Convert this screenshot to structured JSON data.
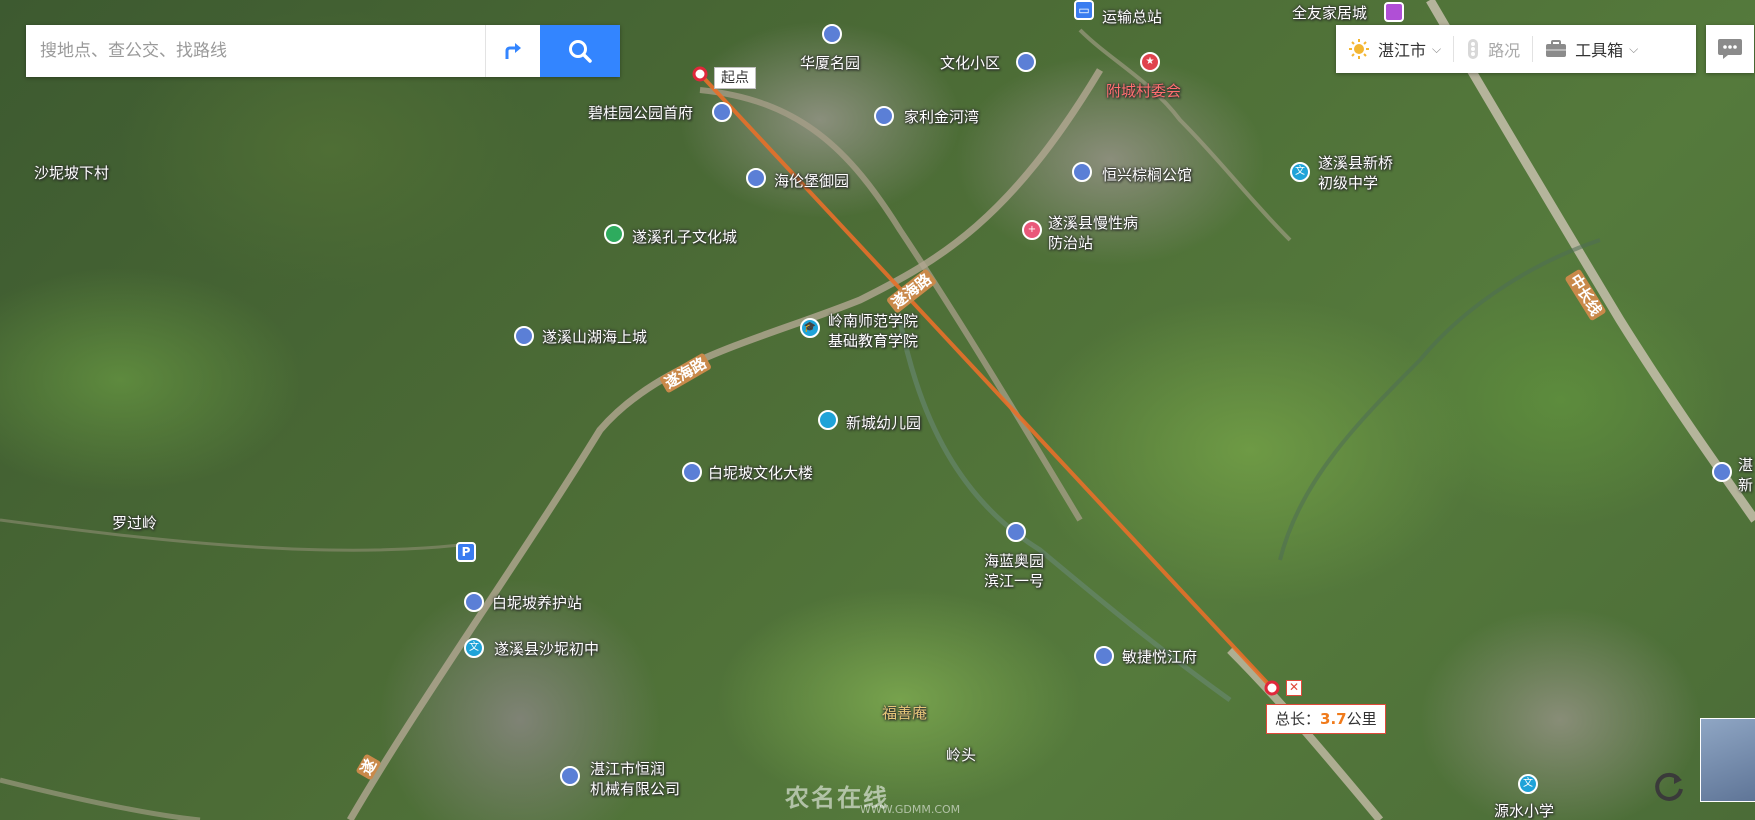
{
  "search": {
    "placeholder": "搜地点、查公交、找路线"
  },
  "toolbar": {
    "city": "湛江市",
    "traffic": "路况",
    "toolbox": "工具箱"
  },
  "measure": {
    "start_label": "起点",
    "total_prefix": "总长：",
    "total_value": "3.7",
    "total_unit": "公里"
  },
  "places": [
    {
      "name": "运输总站"
    },
    {
      "name": "全友家居城"
    },
    {
      "name": "华厦名园"
    },
    {
      "name": "文化小区"
    },
    {
      "name": "附城村委会"
    },
    {
      "name": "碧桂园公园首府"
    },
    {
      "name": "家利金河湾"
    },
    {
      "name": "海伦堡御园"
    },
    {
      "name": "恒兴棕榈公馆"
    },
    {
      "name": "遂溪县新桥"
    },
    {
      "name": "初级中学"
    },
    {
      "name": "沙坭坡下村"
    },
    {
      "name": "遂溪孔子文化城"
    },
    {
      "name": "遂溪县慢性病"
    },
    {
      "name": "防治站"
    },
    {
      "name": "遂溪山湖海上城"
    },
    {
      "name": "岭南师范学院"
    },
    {
      "name": "基础教育学院"
    },
    {
      "name": "新城幼儿园"
    },
    {
      "name": "白坭坡文化大楼"
    },
    {
      "name": "罗过岭"
    },
    {
      "name": "海蓝奥园"
    },
    {
      "name": "滨江一号"
    },
    {
      "name": "白坭坡养护站"
    },
    {
      "name": "遂溪县沙坭初中"
    },
    {
      "name": "敏捷悦江府"
    },
    {
      "name": "福善庵"
    },
    {
      "name": "岭头"
    },
    {
      "name": "湛江市恒润"
    },
    {
      "name": "机械有限公司"
    },
    {
      "name": "源水小学"
    },
    {
      "name": "湛"
    },
    {
      "name": "新"
    }
  ],
  "roads": [
    {
      "name": "遂海路"
    },
    {
      "name": "遂海路"
    },
    {
      "name": "中长线"
    },
    {
      "name": "遂"
    }
  ],
  "watermark": {
    "text": "农名在线",
    "url": "WWW.GDMM.COM"
  },
  "colors": {
    "measure_line": "#e8702a",
    "search_button": "#3385ff",
    "poi_blue": "#5b7fd6"
  }
}
